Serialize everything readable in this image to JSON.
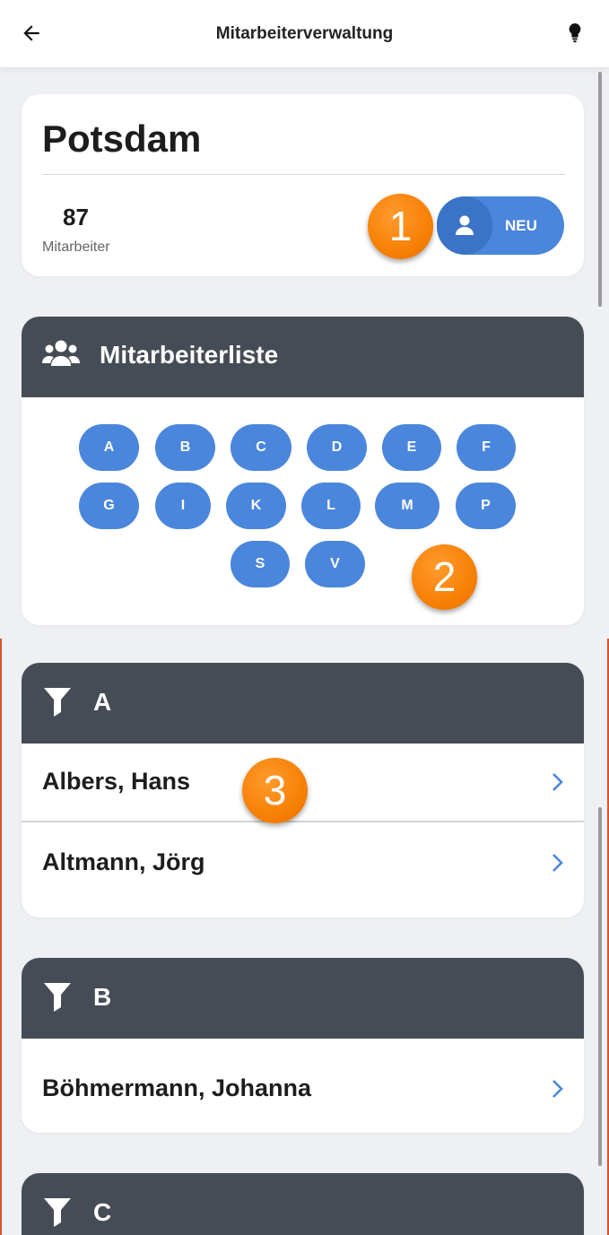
{
  "appbar": {
    "title": "Mitarbeiterverwaltung",
    "back_icon": "arrow-left-icon",
    "hint_icon": "lightbulb-icon"
  },
  "location": {
    "name": "Potsdam",
    "employee_count": "87",
    "employee_count_label": "Mitarbeiter",
    "new_button_label": "NEU"
  },
  "badges": [
    "1",
    "2",
    "3"
  ],
  "employee_list": {
    "title": "Mitarbeiterliste",
    "letters": [
      "A",
      "B",
      "C",
      "D",
      "E",
      "F",
      "G",
      "I",
      "K",
      "L",
      "M",
      "P",
      "S",
      "V"
    ]
  },
  "groups": [
    {
      "letter": "A",
      "employees": [
        "Albers, Hans",
        "Altmann, Jörg"
      ]
    },
    {
      "letter": "B",
      "employees": [
        "Böhmermann, Johanna"
      ]
    },
    {
      "letter": "C",
      "employees": []
    }
  ],
  "colors": {
    "accent": "#4a86dc",
    "header_dark": "#464c56",
    "badge_orange": "#f57c00",
    "background": "#eef0f4"
  }
}
